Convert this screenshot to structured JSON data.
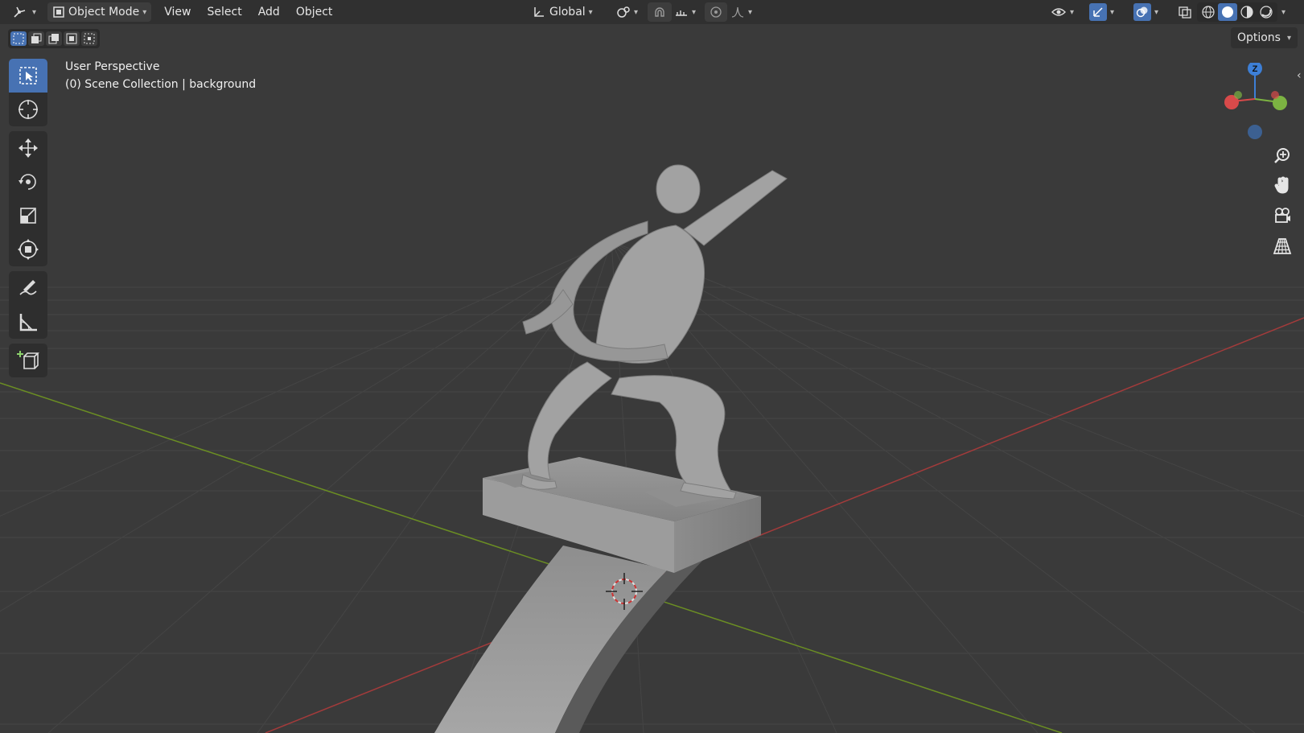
{
  "header": {
    "editor_type_icon": "editor-type-icon",
    "mode_label": "Object Mode",
    "menus": [
      "View",
      "Select",
      "Add",
      "Object"
    ],
    "transform_orientation": "Global"
  },
  "viewport": {
    "view_name": "User Perspective",
    "collection_info": "(0) Scene Collection | background"
  },
  "options_label": "Options",
  "gizmo": {
    "z_label": "Z"
  },
  "colors": {
    "accent": "#4772b3",
    "header_bg": "#303030",
    "viewport_bg": "#3a3a3a",
    "grid_line": "#454545",
    "x_axis": "#a33b3b",
    "y_axis": "#6b8e23",
    "gizmo_x": "#d84a4a",
    "gizmo_y": "#7cb342",
    "gizmo_z": "#3d7fd6"
  },
  "tools": [
    "select-box-icon",
    "cursor-icon",
    "move-icon",
    "rotate-icon",
    "scale-icon",
    "transform-icon",
    "annotate-icon",
    "measure-icon",
    "add-cube-icon"
  ]
}
